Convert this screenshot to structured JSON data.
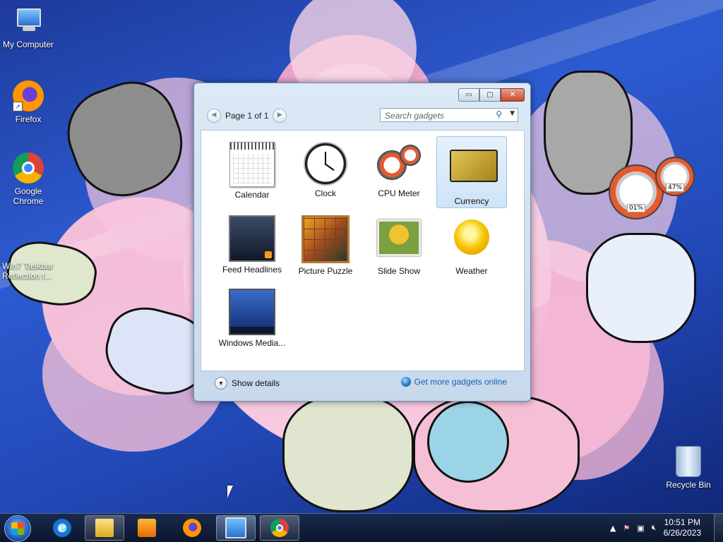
{
  "desktop": {
    "icons": [
      {
        "label": "My Computer",
        "icon": "computer-icon"
      },
      {
        "label": "Firefox",
        "icon": "firefox-icon"
      },
      {
        "label": "Google Chrome",
        "icon": "chrome-icon"
      },
      {
        "label": "Win7 Taskbar Reflection f...",
        "icon": "app-icon"
      },
      {
        "label": "Recycle Bin",
        "icon": "recycle-bin-icon"
      }
    ],
    "meters": {
      "cpu": "01%",
      "memory": "47%"
    }
  },
  "gadget_window": {
    "pager": {
      "label": "Page 1 of 1",
      "prev": "◀",
      "next": "▶"
    },
    "search": {
      "placeholder": "Search gadgets",
      "icon": "search-icon"
    },
    "controls": {
      "minimize": "▭",
      "restore": "▢",
      "close": "✕"
    },
    "gadgets": [
      {
        "name": "Calendar",
        "icon": "calendar-icon"
      },
      {
        "name": "Clock",
        "icon": "clock-icon"
      },
      {
        "name": "CPU Meter",
        "icon": "cpu-meter-icon"
      },
      {
        "name": "Currency",
        "icon": "currency-icon",
        "selected": true
      },
      {
        "name": "Feed Headlines",
        "icon": "feed-icon"
      },
      {
        "name": "Picture Puzzle",
        "icon": "puzzle-icon"
      },
      {
        "name": "Slide Show",
        "icon": "slideshow-icon"
      },
      {
        "name": "Weather",
        "icon": "weather-icon"
      },
      {
        "name": "Windows Media...",
        "icon": "media-center-icon"
      }
    ],
    "footer": {
      "show_details": "Show details",
      "get_more": "Get more gadgets online"
    }
  },
  "taskbar": {
    "pinned": [
      {
        "name": "Internet Explorer",
        "icon": "ie-icon"
      },
      {
        "name": "Windows Explorer",
        "icon": "folder-icon",
        "open": true
      },
      {
        "name": "Windows Media Player",
        "icon": "media-player-icon"
      },
      {
        "name": "Firefox",
        "icon": "firefox-icon"
      },
      {
        "name": "Desktop Gadgets",
        "icon": "gadgets-icon",
        "open": true,
        "active": true
      },
      {
        "name": "Google Chrome",
        "icon": "chrome-icon",
        "open": true
      }
    ],
    "tray": {
      "time": "10:51 PM",
      "date": "6/26/2023"
    }
  },
  "colors": {
    "taskbar": "#142442",
    "window_frame": "#c7d9ec",
    "link": "#1a5fb4",
    "selected": "#cfe4f8"
  }
}
